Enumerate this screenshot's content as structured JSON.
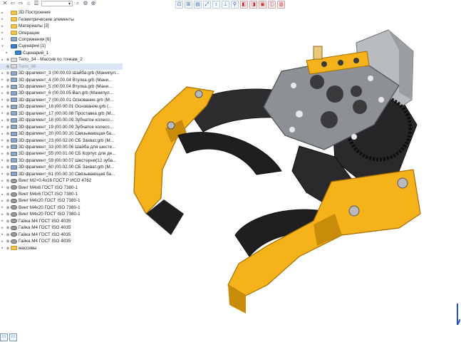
{
  "toolbar": {
    "left_icons": [
      "close-icon",
      "back-icon",
      "forward-icon",
      "home-icon",
      "list-icon"
    ],
    "view_select_value": "",
    "right_icons": [
      "search-icon",
      "gear-icon",
      "close-icon"
    ]
  },
  "toolbar_center_icons": [
    {
      "name": "zoom-fit-icon",
      "glyph": "⊡",
      "red": false
    },
    {
      "name": "zoom-icon",
      "glyph": "⊞",
      "red": false
    },
    {
      "name": "view-icon",
      "glyph": "▤",
      "red": false
    },
    {
      "name": "dimension-icon",
      "glyph": "⤢",
      "red": false
    },
    {
      "name": "orient-icon",
      "glyph": "↕",
      "red": false
    },
    {
      "name": "measure-icon",
      "glyph": "⊥",
      "red": false
    },
    {
      "name": "pin-icon",
      "glyph": "⚲",
      "red": false
    },
    {
      "name": "section-icon",
      "glyph": "◧",
      "red": true
    },
    {
      "name": "cube-icon",
      "glyph": "◨",
      "red": true
    },
    {
      "name": "shade-icon",
      "glyph": "▣",
      "red": true
    },
    {
      "name": "wire-icon",
      "glyph": "◫",
      "red": true
    },
    {
      "name": "hidden-icon",
      "glyph": "▥",
      "red": true
    }
  ],
  "tree": [
    {
      "label": "3D Построения",
      "icon": "folder",
      "exp": "▸",
      "vis": ""
    },
    {
      "label": "Геометрические элементы",
      "icon": "folder",
      "exp": "▸",
      "vis": ""
    },
    {
      "label": "Материалы [3]",
      "icon": "folder",
      "exp": "▸",
      "vis": ""
    },
    {
      "label": "Операции",
      "icon": "folder",
      "exp": "▸",
      "vis": ""
    },
    {
      "label": "Сопряжения [6]",
      "icon": "part",
      "exp": "▸",
      "vis": ""
    },
    {
      "label": "Сценарии [1]",
      "icon": "scen",
      "exp": "▾",
      "vis": ""
    },
    {
      "label": "Сценарий_1",
      "icon": "scen",
      "exp": "▸",
      "vis": "",
      "indent": 6
    },
    {
      "label": "Тело_34 - Массив по точкам_2",
      "icon": "body",
      "exp": "▸",
      "vis": "◉"
    },
    {
      "label": "Тело_86",
      "icon": "body",
      "exp": "",
      "vis": "◉",
      "dim": true,
      "sel": true
    },
    {
      "label": "3D фрагмент_3 (00.00.03 Шайба.grb (Манипул...",
      "icon": "part",
      "exp": "▸",
      "vis": "◉"
    },
    {
      "label": "3D фрагмент_4 (00.00.04 Втулка.grb (Мани...",
      "icon": "part",
      "exp": "▸",
      "vis": "◉"
    },
    {
      "label": "3D фрагмент_5 (00.00.04 Втулка.grb (Мани...",
      "icon": "part",
      "exp": "▸",
      "vis": "◉"
    },
    {
      "label": "3D фрагмент_6 (00.00.05 Вал.grb (Манипул...",
      "icon": "part",
      "exp": "▸",
      "vis": "◉"
    },
    {
      "label": "3D фрагмент_7 (00.00.01 Основание.grb (М...",
      "icon": "part",
      "exp": "▸",
      "vis": "◉"
    },
    {
      "label": "3D фрагмент_16 (00.00.01 Основание.grb (...",
      "icon": "part",
      "exp": "▸",
      "vis": "◉"
    },
    {
      "label": "3D фрагмент_17 (00.00.08 Проставка.grb (М...",
      "icon": "part",
      "exp": "▸",
      "vis": "◉"
    },
    {
      "label": "3D фрагмент_18 (00.00.09 Зубчатое колесо...",
      "icon": "part",
      "exp": "▸",
      "vis": "◉"
    },
    {
      "label": "3D фрагмент_19 (00.00.09 Зубчатое колесо...",
      "icon": "part",
      "exp": "▸",
      "vis": "◉"
    },
    {
      "label": "3D фрагмент_20 (00.00.10 Связывающая ба...",
      "icon": "part",
      "exp": "▸",
      "vis": "◉"
    },
    {
      "label": "3D фрагмент_23 (00.02.00 СБ Захват.grb (М...",
      "icon": "part",
      "exp": "▸",
      "vis": "◉"
    },
    {
      "label": "3D фрагмент_33 (00.00.06 Шайба для шесте...",
      "icon": "part",
      "exp": "▸",
      "vis": "◉"
    },
    {
      "label": "3D фрагмент_55 (00.01.00 СБ Корпус для де...",
      "icon": "part",
      "exp": "▸",
      "vis": "◉"
    },
    {
      "label": "3D фрагмент_59 (00.00.07 Шестерня(12 зуба...",
      "icon": "part",
      "exp": "▸",
      "vis": "◉"
    },
    {
      "label": "3D фрагмент_60 (00.02.00 СБ Захват.grb (М...",
      "icon": "part",
      "exp": "▸",
      "vis": "◉"
    },
    {
      "label": "3D фрагмент_61 (00.00.10 Связывающая ба...",
      "icon": "part",
      "exp": "▸",
      "vis": "◉"
    },
    {
      "label": "Винт M2×0.4x16 ГОСТ Р ИСО 4762",
      "icon": "screw",
      "exp": "▸",
      "vis": "◉"
    },
    {
      "label": "Винт M4x6 ГОСТ ISO 7380-1",
      "icon": "screw",
      "exp": "▸",
      "vis": "◉"
    },
    {
      "label": "Винт M4x6 ГОСТ ISO 7380-1",
      "icon": "screw",
      "exp": "▸",
      "vis": "◉"
    },
    {
      "label": "Винт M4x20 ГОСТ ISO 7380-1",
      "icon": "screw",
      "exp": "▸",
      "vis": "◉"
    },
    {
      "label": "Винт M4x20 ГОСТ ISO 7380-1",
      "icon": "screw",
      "exp": "▸",
      "vis": "◉"
    },
    {
      "label": "Винт M4x20 ГОСТ ISO 7380-1",
      "icon": "screw",
      "exp": "▸",
      "vis": "◉"
    },
    {
      "label": "Гайка M4 ГОСТ ISO 4035",
      "icon": "screw",
      "exp": "▸",
      "vis": "◉"
    },
    {
      "label": "Гайка M4 ГОСТ ISO 4035",
      "icon": "screw",
      "exp": "▸",
      "vis": "◉"
    },
    {
      "label": "Гайка M4 ГОСТ ISO 4035",
      "icon": "screw",
      "exp": "▸",
      "vis": "◉"
    },
    {
      "label": "Гайка M4 ГОСТ ISO 4035",
      "icon": "screw",
      "exp": "▸",
      "vis": "◉"
    },
    {
      "label": "массивы",
      "icon": "folder",
      "exp": "▸",
      "vis": "◉"
    }
  ],
  "colors": {
    "yellow": "#f5b21b",
    "yellow_dark": "#c9890a",
    "black": "#222222",
    "steel": "#8a8d92",
    "steel_light": "#c3c6ca"
  },
  "bottom_buttons": [
    "panel-icon",
    "layout-icon"
  ]
}
